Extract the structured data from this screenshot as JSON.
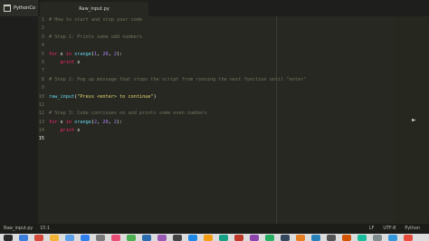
{
  "sidebar": {
    "project_name": "PythonCo"
  },
  "tabs": [
    {
      "label": "Raw_input.py"
    }
  ],
  "editor": {
    "lines": [
      {
        "n": "1",
        "parts": [
          [
            "comment",
            "# How to start and stop your code"
          ]
        ]
      },
      {
        "n": "2",
        "parts": []
      },
      {
        "n": "3",
        "parts": [
          [
            "comment",
            "# Step 1: Prints some odd numbers"
          ]
        ]
      },
      {
        "n": "4",
        "parts": []
      },
      {
        "n": "5",
        "parts": [
          [
            "kw",
            "for"
          ],
          [
            "plain",
            " x "
          ],
          [
            "kw",
            "in"
          ],
          [
            "plain",
            " "
          ],
          [
            "fn",
            "xrange"
          ],
          [
            "plain",
            "("
          ],
          [
            "num-lit",
            "1"
          ],
          [
            "plain",
            ", "
          ],
          [
            "num-lit",
            "20"
          ],
          [
            "plain",
            ", "
          ],
          [
            "num-lit",
            "2"
          ],
          [
            "plain",
            "):"
          ]
        ]
      },
      {
        "n": "6",
        "parts": [
          [
            "plain",
            "    "
          ],
          [
            "kw",
            "print"
          ],
          [
            "plain",
            " x"
          ]
        ]
      },
      {
        "n": "7",
        "parts": []
      },
      {
        "n": "8",
        "parts": [
          [
            "comment",
            "# Step 2: Pop up message that stops the script from running the next function until \"enter\""
          ]
        ]
      },
      {
        "n": "9",
        "parts": []
      },
      {
        "n": "10",
        "parts": [
          [
            "fn",
            "raw_input"
          ],
          [
            "plain",
            "("
          ],
          [
            "str",
            "\"Press <enter> to continue\""
          ],
          [
            "plain",
            ")"
          ]
        ]
      },
      {
        "n": "11",
        "parts": []
      },
      {
        "n": "12",
        "parts": [
          [
            "comment",
            "# Step 3: Code continues on and prints some even numbers"
          ]
        ]
      },
      {
        "n": "13",
        "parts": [
          [
            "kw",
            "for"
          ],
          [
            "plain",
            " x "
          ],
          [
            "kw",
            "in"
          ],
          [
            "plain",
            " "
          ],
          [
            "fn",
            "xrange"
          ],
          [
            "plain",
            "("
          ],
          [
            "num-lit",
            "2"
          ],
          [
            "plain",
            ", "
          ],
          [
            "num-lit",
            "20"
          ],
          [
            "plain",
            ", "
          ],
          [
            "num-lit",
            "2"
          ],
          [
            "plain",
            "):"
          ]
        ]
      },
      {
        "n": "14",
        "parts": [
          [
            "plain",
            "    "
          ],
          [
            "kw",
            "print"
          ],
          [
            "plain",
            " x"
          ]
        ]
      },
      {
        "n": "15",
        "parts": []
      }
    ]
  },
  "status": {
    "file": "Raw_input.py",
    "position": "15:1",
    "line_ending": "LF",
    "encoding": "UTF-8",
    "syntax": "Python"
  },
  "colors": {
    "background": "#272822",
    "comment": "#75715e",
    "keyword": "#f92672",
    "builtin": "#66d9ef",
    "number": "#ae81ff",
    "string": "#e6db74"
  },
  "dock": {
    "icons": [
      "#2a2a2a",
      "#3b7dd8",
      "#d64b3a",
      "#f2b233",
      "#5aa0e8",
      "#2f80ed",
      "#7a7a7a",
      "#e94e77",
      "#4caf50",
      "#2b6cb0",
      "#9b59b6",
      "#444444",
      "#1e88e5",
      "#f39c12",
      "#16a085",
      "#c0392b",
      "#8e44ad",
      "#27ae60",
      "#34495e",
      "#e67e22",
      "#2980b9",
      "#555555",
      "#d35400",
      "#1abc9c",
      "#7f8c8d",
      "#3498db",
      "#e74c3c"
    ]
  }
}
